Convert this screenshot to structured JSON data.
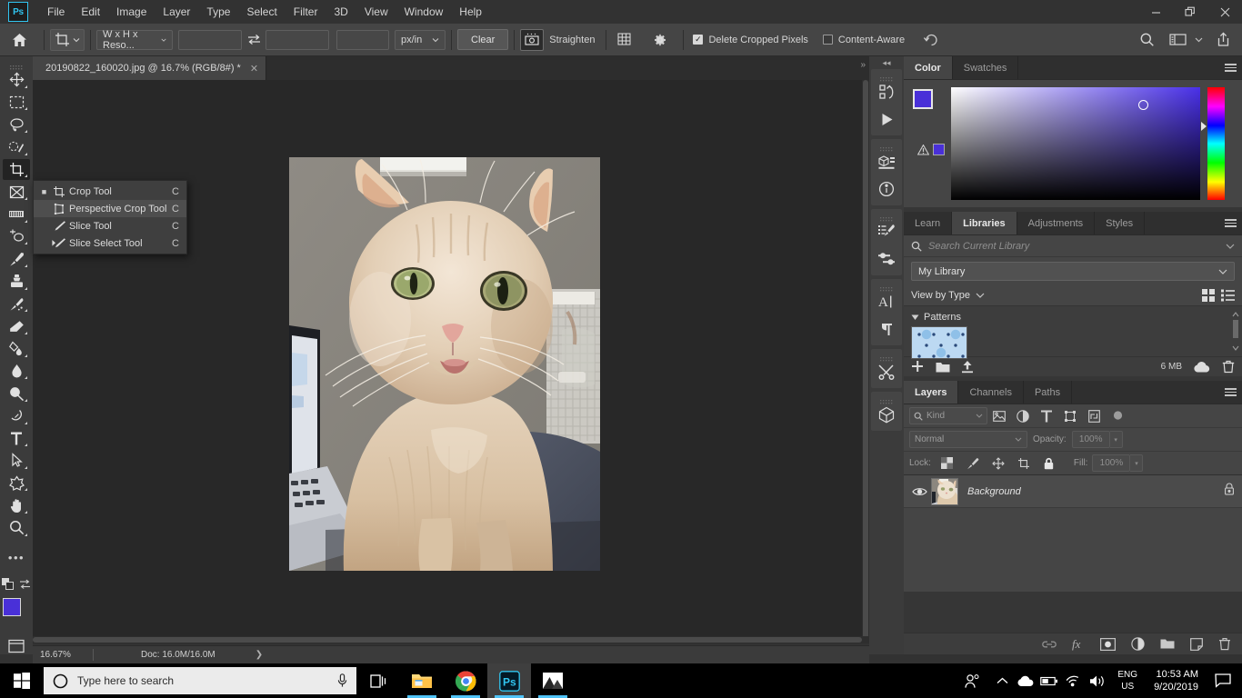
{
  "menubar": {
    "logo": "Ps",
    "items": [
      "File",
      "Edit",
      "Image",
      "Layer",
      "Type",
      "Select",
      "Filter",
      "3D",
      "View",
      "Window",
      "Help"
    ],
    "window_controls": {
      "minimize": "—",
      "restore": "❐",
      "close": "✕"
    }
  },
  "options_bar": {
    "home_icon": "home-icon",
    "tool_icon": "crop-tool-icon",
    "ratio_select": "W x H x Reso...",
    "width_value": "",
    "width_placeholder": "",
    "swap_icon": "swap-icon",
    "height_value": "",
    "resolution_value": "",
    "unit_select": "px/in",
    "clear_label": "Clear",
    "straighten_label": "Straighten",
    "overlay_icon": "grid-overlay-icon",
    "settings_icon": "gear-icon",
    "delete_cropped_label": "Delete Cropped Pixels",
    "delete_cropped_checked": true,
    "content_aware_label": "Content-Aware",
    "content_aware_checked": false,
    "reset_icon": "reset-icon",
    "search_icon": "search-icon",
    "workspace_icon": "workspace-icon",
    "share_icon": "share-icon"
  },
  "document": {
    "tab_title": "20190822_160020.jpg @ 16.7% (RGB/8#) *",
    "close_label": "✕",
    "collapse_label": "»"
  },
  "toolbar": {
    "tools": [
      {
        "name": "move-tool",
        "selected": false
      },
      {
        "name": "rectangular-marquee-tool",
        "selected": false
      },
      {
        "name": "lasso-tool",
        "selected": false
      },
      {
        "name": "object-selection-tool",
        "selected": false
      },
      {
        "name": "crop-tool",
        "selected": true
      },
      {
        "name": "frame-tool",
        "selected": false
      },
      {
        "name": "eyedropper-tool",
        "selected": false
      },
      {
        "name": "spot-healing-brush-tool",
        "selected": false
      },
      {
        "name": "brush-tool",
        "selected": false
      },
      {
        "name": "clone-stamp-tool",
        "selected": false
      },
      {
        "name": "history-brush-tool",
        "selected": false
      },
      {
        "name": "eraser-tool",
        "selected": false
      },
      {
        "name": "gradient-tool",
        "selected": false
      },
      {
        "name": "blur-tool",
        "selected": false
      },
      {
        "name": "dodge-tool",
        "selected": false
      },
      {
        "name": "pen-tool",
        "selected": false
      },
      {
        "name": "type-tool",
        "selected": false
      },
      {
        "name": "path-selection-tool",
        "selected": false
      },
      {
        "name": "shape-tool",
        "selected": false
      },
      {
        "name": "hand-tool",
        "selected": false
      },
      {
        "name": "zoom-tool",
        "selected": false
      }
    ],
    "more_label": "•••",
    "foreground_color": "#4930d8",
    "background_color": "#ffffff"
  },
  "flyout": {
    "items": [
      {
        "label": "Crop Tool",
        "shortcut": "C",
        "bullet": "■",
        "icon": "crop-tool-icon",
        "highlighted": false
      },
      {
        "label": "Perspective Crop Tool",
        "shortcut": "C",
        "bullet": "",
        "icon": "perspective-crop-tool-icon",
        "highlighted": true
      },
      {
        "label": "Slice Tool",
        "shortcut": "C",
        "bullet": "",
        "icon": "slice-tool-icon",
        "highlighted": false
      },
      {
        "label": "Slice Select Tool",
        "shortcut": "C",
        "bullet": "",
        "icon": "slice-select-tool-icon",
        "highlighted": false
      }
    ]
  },
  "status_bar": {
    "zoom": "16.67%",
    "doc_info": "Doc: 16.0M/16.0M",
    "arrow": "❯"
  },
  "rail": {
    "collapse": "◂◂",
    "icons": [
      "history-icon",
      "play-icon",
      "3d-panel-icon",
      "info-icon",
      "brush-presets-icon",
      "tool-presets-icon",
      "character-icon",
      "paragraph-icon",
      "tools-icon",
      "3d-object-icon"
    ]
  },
  "color_panel": {
    "tabs": [
      {
        "label": "Color",
        "active": true
      },
      {
        "label": "Swatches",
        "active": false
      }
    ],
    "menu_icon": "panel-menu-icon",
    "foreground": "#4930d8",
    "background": "#ffffff",
    "warning_icon": "gamut-warning-icon",
    "warning_color": "#4930d8"
  },
  "libraries_panel": {
    "tabs": [
      {
        "label": "Learn",
        "active": false
      },
      {
        "label": "Libraries",
        "active": true
      },
      {
        "label": "Adjustments",
        "active": false
      },
      {
        "label": "Styles",
        "active": false
      }
    ],
    "menu_icon": "panel-menu-icon",
    "search_icon": "search-icon",
    "search_value": "",
    "search_placeholder": "Search Current Library",
    "library_select": "My Library",
    "view_by_label": "View by Type",
    "grid_view_icon": "grid-view-icon",
    "list_view_icon": "list-view-icon",
    "section_title": "Patterns",
    "section_expanded": true,
    "pattern_item_name": "blue-polka-dot-pattern",
    "add_icon": "add-icon",
    "folder_icon": "folder-icon",
    "upload_icon": "upload-icon",
    "size_label": "6 MB",
    "cloud_icon": "cloud-icon",
    "delete_icon": "trash-icon"
  },
  "layers_panel": {
    "tabs": [
      {
        "label": "Layers",
        "active": true
      },
      {
        "label": "Channels",
        "active": false
      },
      {
        "label": "Paths",
        "active": false
      }
    ],
    "menu_icon": "panel-menu-icon",
    "filter_kind": "Kind",
    "filter_icons": [
      "filter-pixel-icon",
      "filter-adjustment-icon",
      "filter-type-icon",
      "filter-shape-icon",
      "filter-smart-object-icon"
    ],
    "filter_toggle_icon": "filter-toggle-icon",
    "blend_mode": "Normal",
    "opacity_label": "Opacity:",
    "opacity_value": "100%",
    "lock_label": "Lock:",
    "lock_icons": [
      "lock-transparent-icon",
      "lock-image-icon",
      "lock-position-icon",
      "lock-artboard-icon",
      "lock-all-icon"
    ],
    "fill_label": "Fill:",
    "fill_value": "100%",
    "layers": [
      {
        "name": "Background",
        "visible": true,
        "locked": true,
        "thumbnail": "cat-photo-thumbnail"
      }
    ],
    "footer_icons": [
      "link-layers-icon",
      "layer-styles-icon",
      "layer-mask-icon",
      "adjustment-layer-icon",
      "new-group-icon",
      "new-layer-icon",
      "delete-layer-icon"
    ]
  },
  "taskbar": {
    "start_icon": "windows-start-icon",
    "search_icon": "cortana-circle-icon",
    "search_placeholder": "Type here to search",
    "mic_icon": "microphone-icon",
    "taskview_icon": "task-view-icon",
    "apps": [
      {
        "name": "file-explorer",
        "running": true,
        "active": false
      },
      {
        "name": "google-chrome",
        "running": true,
        "active": false
      },
      {
        "name": "adobe-photoshop",
        "running": true,
        "active": true
      },
      {
        "name": "photos",
        "running": true,
        "active": false
      }
    ],
    "tray": {
      "people_icon": "people-icon",
      "chevron_icon": "show-hidden-icons-icon",
      "onedrive_icon": "onedrive-cloud-icon",
      "battery_icon": "battery-icon",
      "wifi_icon": "wifi-icon",
      "volume_icon": "volume-icon",
      "lang_line1": "ENG",
      "lang_line2": "US",
      "time": "10:53 AM",
      "date": "9/20/2019",
      "action_center_icon": "action-center-icon"
    }
  }
}
